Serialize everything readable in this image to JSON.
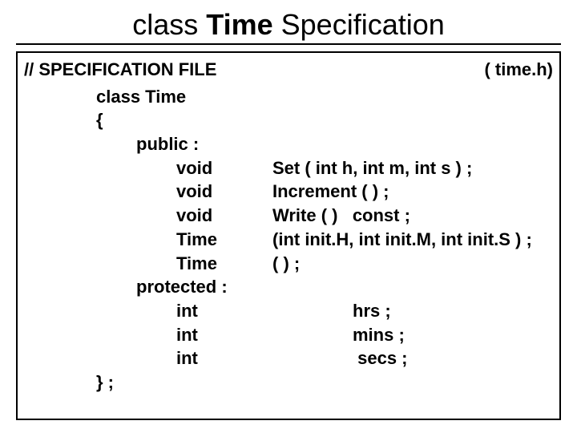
{
  "title_prefix": "class ",
  "title_bold": "Time",
  "title_suffix": " Specification",
  "header": {
    "left": "// SPECIFICATION   FILE",
    "right": "( time.h)"
  },
  "code": {
    "class_decl": "class   Time",
    "open_brace": "{",
    "public_label": "public :",
    "members_public": [
      {
        "type": "void",
        "rest": "Set ( int h, int m, int s ) ;"
      },
      {
        "type": "void",
        "rest": "Increment ( ) ;"
      },
      {
        "type": "void",
        "rest": "Write ( )   const ;"
      },
      {
        "type": "Time",
        "rest": "(int init.H, int init.M, int init.S ) ;"
      },
      {
        "type": "Time",
        "rest": "( ) ;"
      }
    ],
    "protected_label": "protected :",
    "members_protected": [
      {
        "type": "int",
        "name": "hrs ;"
      },
      {
        "type": "int",
        "name": "mins ;"
      },
      {
        "type": "int",
        "name": " secs ;"
      }
    ],
    "close": "} ;"
  }
}
